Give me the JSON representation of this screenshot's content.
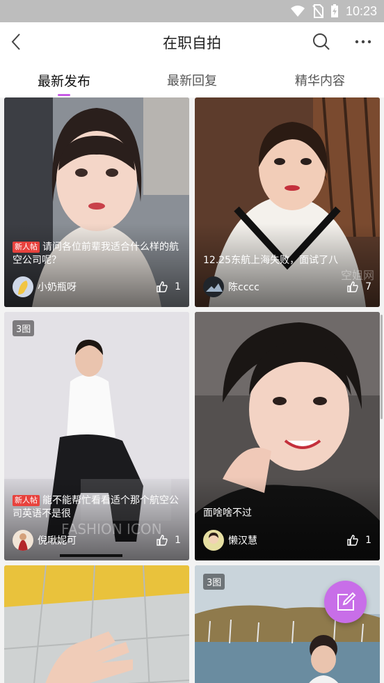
{
  "status_bar": {
    "time": "10:23"
  },
  "header": {
    "title": "在职自拍"
  },
  "tabs": [
    {
      "label": "最新发布",
      "active": true
    },
    {
      "label": "最新回复",
      "active": false
    },
    {
      "label": "精华内容",
      "active": false
    }
  ],
  "new_badge": "新人帖",
  "posts": [
    {
      "title": "请问各位前辈我适合什么样的航空公司呢？",
      "is_new": true,
      "author": "小奶瓶呀",
      "likes": "1"
    },
    {
      "title": "12.25东航上海失败，面试了八",
      "is_new": false,
      "author": "陈cccc",
      "likes": "7",
      "watermark": "空姐网"
    },
    {
      "title": "能不能帮忙看看适个那个航空公司英语不是很",
      "is_new": true,
      "author": "倪啾妮可",
      "likes": "1",
      "image_count": "3图",
      "watermark": "FASHION ICON"
    },
    {
      "title": "面啥啥不过",
      "is_new": false,
      "author": "懒汉慧",
      "likes": "1"
    },
    {
      "title": "",
      "is_new": false,
      "author": "",
      "likes": ""
    },
    {
      "title": "",
      "is_new": false,
      "author": "",
      "likes": "",
      "image_count": "3图"
    }
  ],
  "colors": {
    "accent": "#c75be6",
    "fab": "#c86ee8",
    "new_badge": "#e8423d"
  },
  "icons": {
    "back": "chevron-left-icon",
    "search": "search-icon",
    "more": "more-dots-icon",
    "like": "thumbs-up-icon",
    "compose": "edit-icon"
  }
}
